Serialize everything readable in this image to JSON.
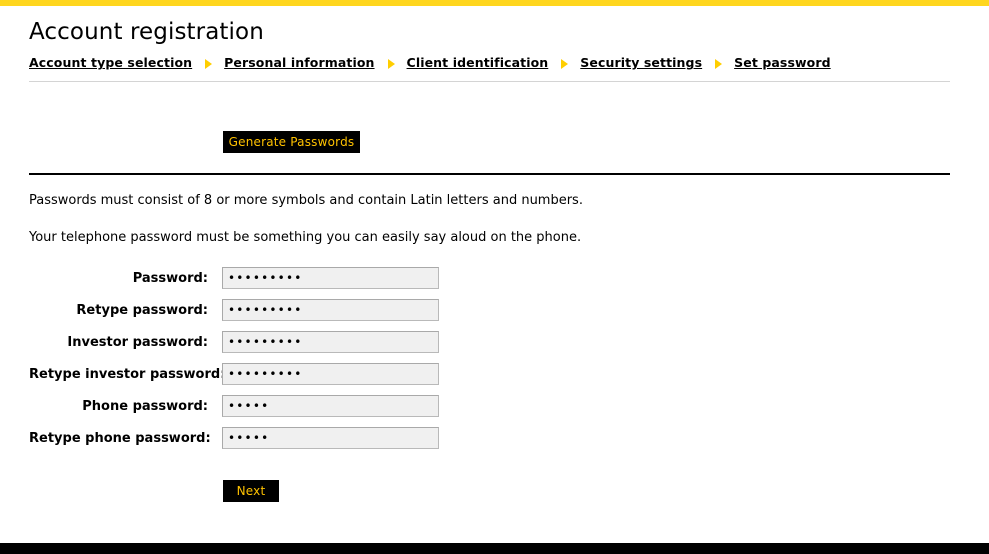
{
  "theme": {
    "accent_yellow": "#ffd61e",
    "button_bg": "#000000",
    "button_text": "#ffc200",
    "input_bg": "#f0f0f0",
    "input_border": "#b9b9b9",
    "footer_bar": "#000000"
  },
  "header": {
    "title": "Account registration"
  },
  "breadcrumb": {
    "separator_icon": "triangle-right-icon",
    "steps": [
      {
        "label": "Account type selection"
      },
      {
        "label": "Personal information"
      },
      {
        "label": "Client identification"
      },
      {
        "label": "Security settings"
      },
      {
        "label": "Set password"
      }
    ]
  },
  "actions": {
    "generate_label": "Generate Passwords",
    "next_label": "Next"
  },
  "notes": [
    "Passwords must consist of 8 or more symbols and contain Latin letters and numbers.",
    "Your telephone password must be something you can easily say aloud on the phone."
  ],
  "form": {
    "fields": [
      {
        "label": "Password:",
        "value": "•••••••••",
        "placeholder": ""
      },
      {
        "label": "Retype password:",
        "value": "•••••••••",
        "placeholder": ""
      },
      {
        "label": "Investor password:",
        "value": "•••••••••",
        "placeholder": ""
      },
      {
        "label": "Retype investor password:",
        "value": "•••••••••",
        "placeholder": ""
      },
      {
        "label": "Phone password:",
        "value": "•••••",
        "placeholder": ""
      },
      {
        "label": "Retype phone password:",
        "value": "•••••",
        "placeholder": ""
      }
    ]
  }
}
